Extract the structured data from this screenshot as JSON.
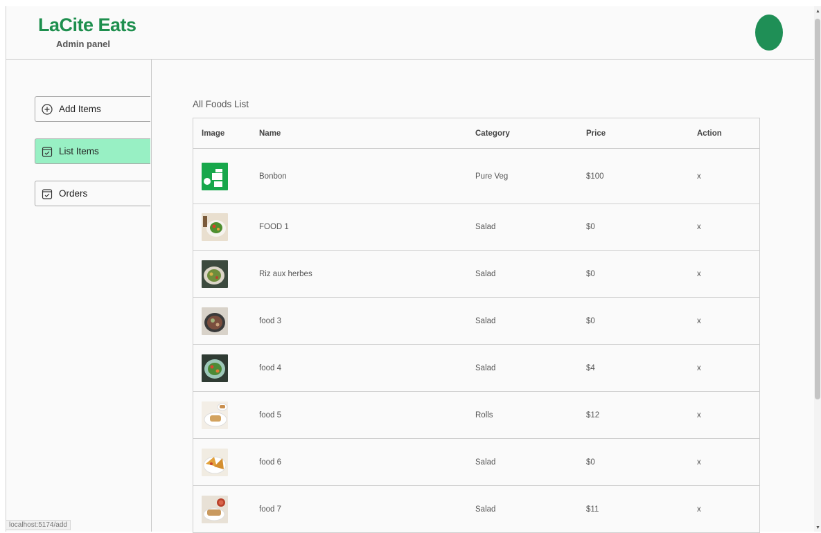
{
  "brand": {
    "title": "LaCite Eats",
    "subtitle": "Admin panel"
  },
  "sidebar": {
    "items": [
      {
        "label": "Add Items",
        "icon": "plus-circle-icon",
        "active": false
      },
      {
        "label": "List Items",
        "icon": "checklist-icon",
        "active": true
      },
      {
        "label": "Orders",
        "icon": "order-icon",
        "active": false
      }
    ]
  },
  "main": {
    "title": "All Foods List",
    "columns": [
      "Image",
      "Name",
      "Category",
      "Price",
      "Action"
    ],
    "rows": [
      {
        "name": "Bonbon",
        "category": "Pure Veg",
        "price": "$100",
        "action": "x",
        "image": "logo-thumbnail"
      },
      {
        "name": "FOOD 1",
        "category": "Salad",
        "price": "$0",
        "action": "x",
        "image": "salad-photo"
      },
      {
        "name": "Riz aux herbes",
        "category": "Salad",
        "price": "$0",
        "action": "x",
        "image": "salad-photo"
      },
      {
        "name": "food 3",
        "category": "Salad",
        "price": "$0",
        "action": "x",
        "image": "salad-photo"
      },
      {
        "name": "food 4",
        "category": "Salad",
        "price": "$4",
        "action": "x",
        "image": "salad-photo"
      },
      {
        "name": "food 5",
        "category": "Rolls",
        "price": "$12",
        "action": "x",
        "image": "rolls-photo"
      },
      {
        "name": "food 6",
        "category": "Salad",
        "price": "$0",
        "action": "x",
        "image": "rolls-photo"
      },
      {
        "name": "food 7",
        "category": "Salad",
        "price": "$11",
        "action": "x",
        "image": "rolls-photo"
      }
    ]
  },
  "status_url": "localhost:5174/add",
  "colors": {
    "brand": "#1e8f4e",
    "active_item": "#98f0c4",
    "avatar": "#1f8f56"
  }
}
